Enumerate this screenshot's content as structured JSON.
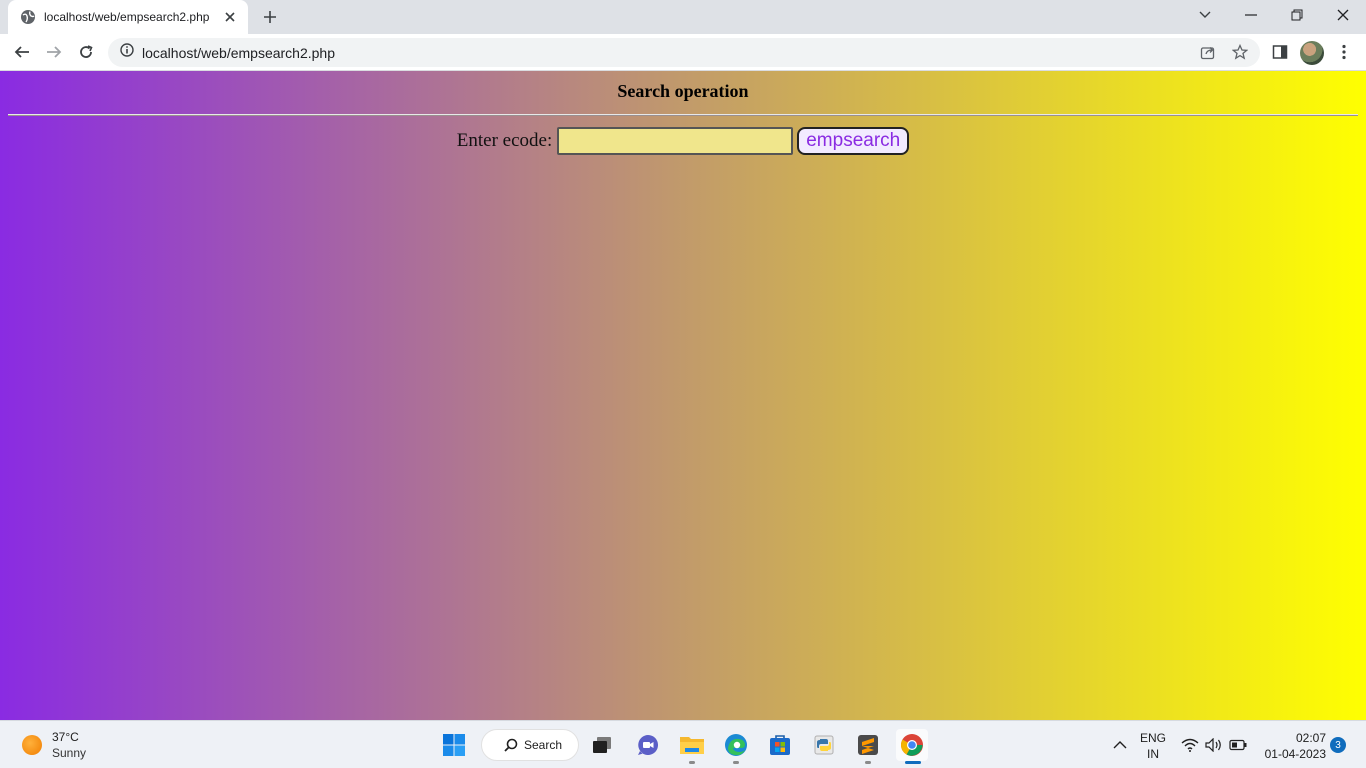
{
  "browser": {
    "tab_title": "localhost/web/empsearch2.php",
    "url": "localhost/web/empsearch2.php"
  },
  "page": {
    "heading": "Search operation",
    "label": "Enter ecode:",
    "input_value": "",
    "button_label": "empsearch",
    "colors": {
      "gradient_start": "#8a2be2",
      "gradient_end": "#ffff00",
      "input_bg": "#f0e68c",
      "button_text": "#8a2be2"
    }
  },
  "taskbar": {
    "weather_temp": "37°C",
    "weather_condition": "Sunny",
    "search_label": "Search",
    "lang_line1": "ENG",
    "lang_line2": "IN",
    "time": "02:07",
    "date": "01-04-2023",
    "notification_count": "3",
    "apps": [
      "start-icon",
      "task-view-icon",
      "chat-icon",
      "file-explorer-icon",
      "edge-icon",
      "store-icon",
      "python-icon",
      "sublime-text-icon",
      "chrome-icon"
    ]
  }
}
